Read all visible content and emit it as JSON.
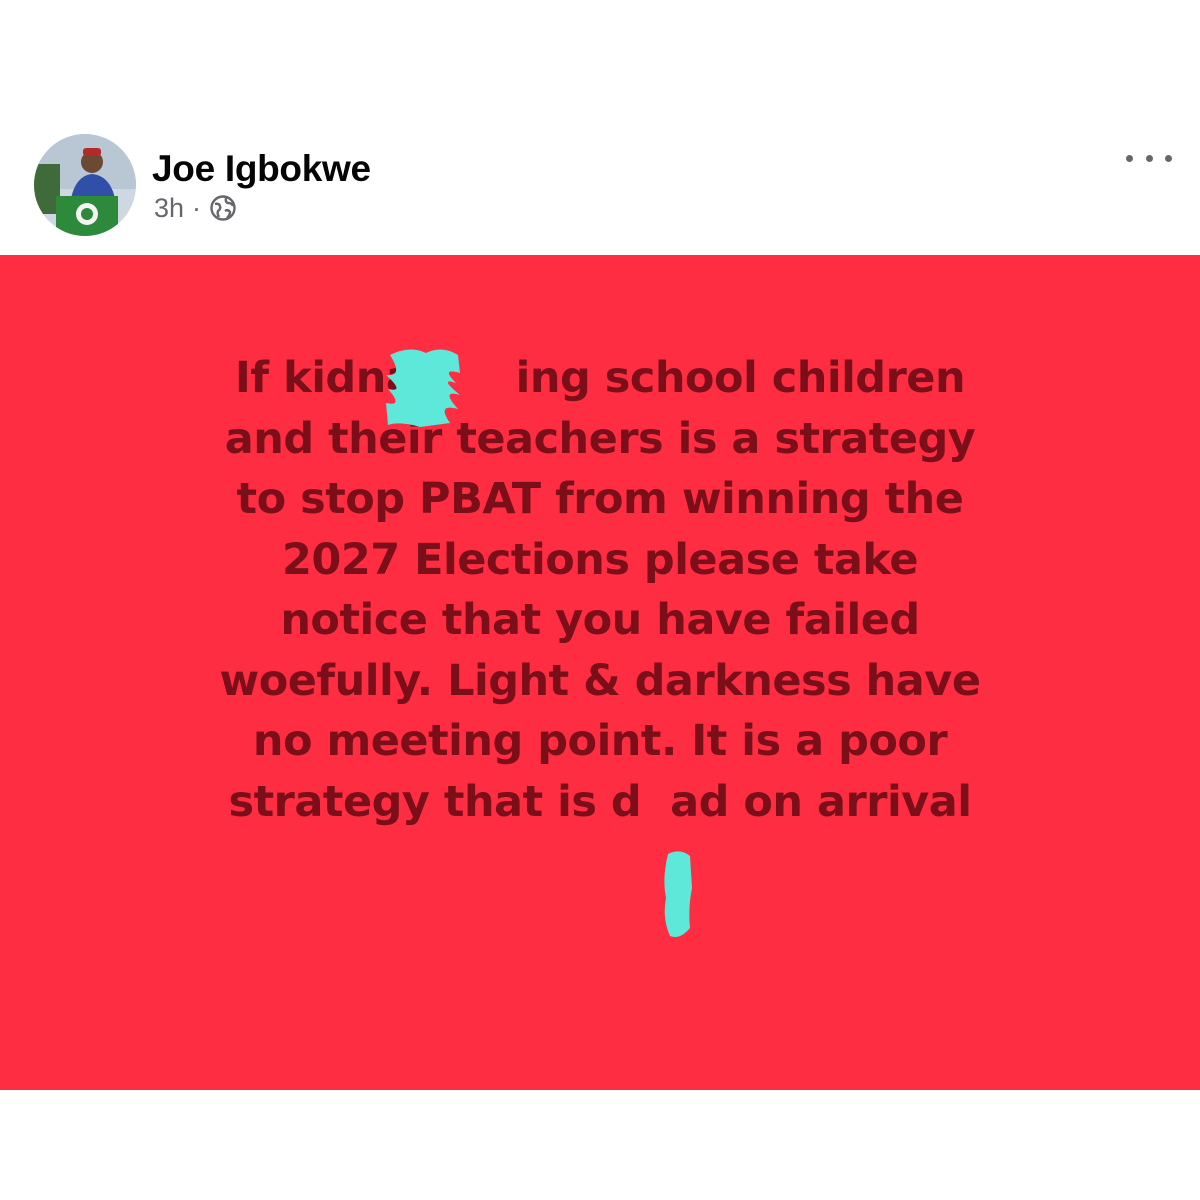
{
  "post": {
    "author": {
      "name": "Joe Igbokwe",
      "avatar_icon": "profile-photo"
    },
    "timestamp": "3h",
    "separator": "·",
    "audience_icon": "globe-icon",
    "more_icon": "more-options-icon",
    "background_color": "#ff2d41",
    "text_color": "#7a0f1a",
    "redaction_color": "#5ee8d9",
    "text_lines": [
      "If kidna       ing school children",
      "and their teachers is a strategy",
      "to stop PBAT from winning the",
      "2027 Elections please take",
      "notice that you have failed",
      "woefully. Light & darkness have",
      "no meeting point. It is a poor",
      "strategy that is d  ad on arrival"
    ]
  }
}
